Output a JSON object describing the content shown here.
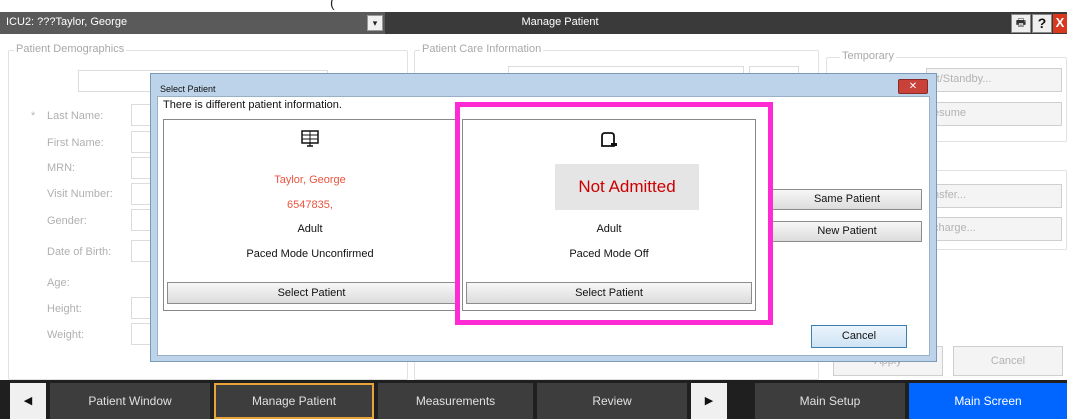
{
  "titlebar": {
    "patient_selector": "ICU2: ???Taylor, George",
    "dropdown_glyph": "▾",
    "window_title": "Manage Patient",
    "printer_icon": "🖶",
    "help_label": "?",
    "close_label": "X",
    "cut_off_text": "("
  },
  "demographics": {
    "group_title": "Patient Demographics",
    "required_marker": "*",
    "fields": [
      "Last Name:",
      "First Name:",
      "MRN:",
      "Visit Number:",
      "Gender:",
      "Date of Birth:",
      "Age:",
      "Height:",
      "Weight:"
    ]
  },
  "care_info": {
    "group_title": "Patient Care Information"
  },
  "temporary": {
    "group_title": "Temporary",
    "buttons": [
      "rt/Standby...",
      "esume",
      "nsfer...",
      "charge..."
    ]
  },
  "footer": {
    "apply_label": "Apply",
    "cancel_label": "Cancel"
  },
  "dialog": {
    "title": "Select Patient",
    "close_glyph": "✕",
    "message": "There is different patient information.",
    "left_panel": {
      "icon": "monitor-grid-icon",
      "name": "Taylor, George",
      "mrn": "6547835,",
      "category": "Adult",
      "paced_mode": "Paced Mode Unconfirmed",
      "button": "Select Patient"
    },
    "right_panel": {
      "icon": "device-box-icon",
      "status": "Not Admitted",
      "category": "Adult",
      "paced_mode": "Paced Mode Off",
      "button": "Select Patient"
    },
    "same_patient": "Same Patient",
    "new_patient": "New Patient",
    "cancel": "Cancel"
  },
  "nav": {
    "left_arrow": "◀",
    "right_arrow": "▶",
    "items": [
      "Patient Window",
      "Manage Patient",
      "Measurements",
      "Review",
      "Main Setup",
      "Main Screen"
    ]
  },
  "colors": {
    "highlight": "#ff2ad4",
    "not_admitted": "#cc0000",
    "patient_name": "#e8553f",
    "main_screen": "#0066ff",
    "active_tab_border": "#e8a33a"
  }
}
